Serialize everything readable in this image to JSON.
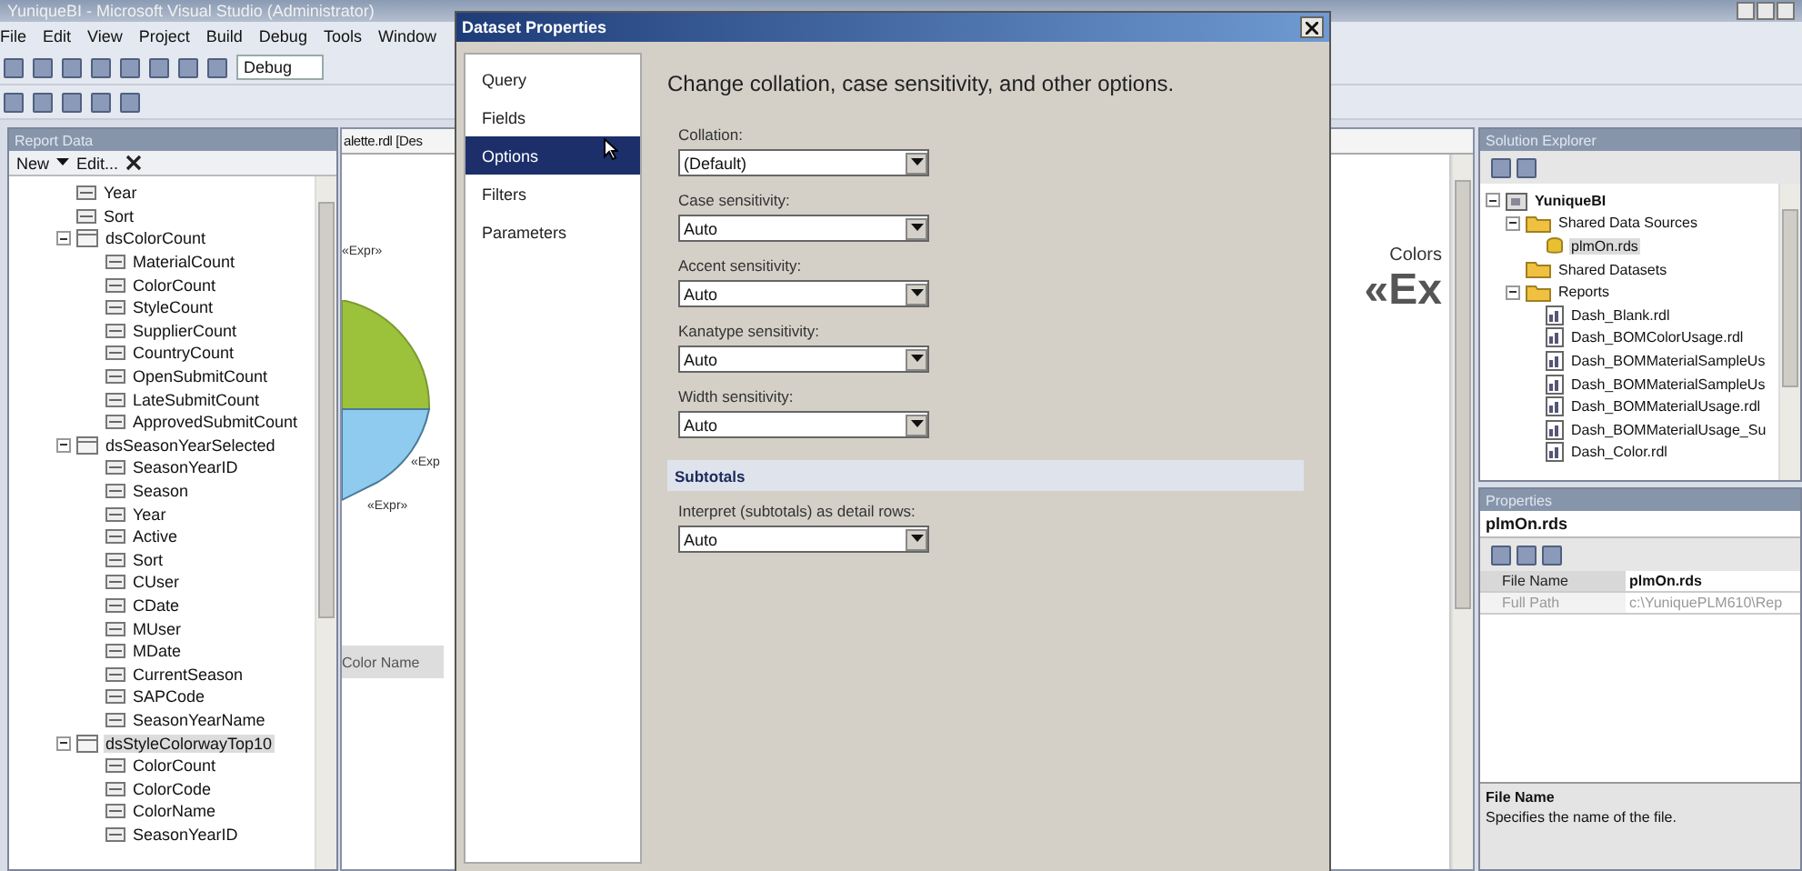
{
  "window": {
    "title": "YuniqueBI - Microsoft Visual Studio (Administrator)"
  },
  "menu": [
    "File",
    "Edit",
    "View",
    "Project",
    "Build",
    "Debug",
    "Tools",
    "Window"
  ],
  "toolbar": {
    "configuration": "Debug"
  },
  "report_data": {
    "title": "Report Data",
    "new": "New",
    "edit": "Edit...",
    "tree": [
      {
        "label": "Year",
        "kind": "field",
        "selected": false
      },
      {
        "label": "Sort",
        "kind": "field",
        "selected": false
      },
      {
        "label": "dsColorCount",
        "kind": "dataset",
        "expanded": true,
        "selected": false,
        "children": [
          {
            "label": "MaterialCount",
            "kind": "field",
            "selected": false
          },
          {
            "label": "ColorCount",
            "kind": "field",
            "selected": false
          },
          {
            "label": "StyleCount",
            "kind": "field",
            "selected": false
          },
          {
            "label": "SupplierCount",
            "kind": "field",
            "selected": false
          },
          {
            "label": "CountryCount",
            "kind": "field",
            "selected": false
          },
          {
            "label": "OpenSubmitCount",
            "kind": "field",
            "selected": false
          },
          {
            "label": "LateSubmitCount",
            "kind": "field",
            "selected": false
          },
          {
            "label": "ApprovedSubmitCount",
            "kind": "field",
            "selected": false
          }
        ]
      },
      {
        "label": "dsSeasonYearSelected",
        "kind": "dataset",
        "expanded": true,
        "selected": false,
        "children": [
          {
            "label": "SeasonYearID",
            "kind": "field",
            "selected": false
          },
          {
            "label": "Season",
            "kind": "field",
            "selected": false
          },
          {
            "label": "Year",
            "kind": "field",
            "selected": false
          },
          {
            "label": "Active",
            "kind": "field",
            "selected": false
          },
          {
            "label": "Sort",
            "kind": "field",
            "selected": false
          },
          {
            "label": "CUser",
            "kind": "field",
            "selected": false
          },
          {
            "label": "CDate",
            "kind": "field",
            "selected": false
          },
          {
            "label": "MUser",
            "kind": "field",
            "selected": false
          },
          {
            "label": "MDate",
            "kind": "field",
            "selected": false
          },
          {
            "label": "CurrentSeason",
            "kind": "field",
            "selected": false
          },
          {
            "label": "SAPCode",
            "kind": "field",
            "selected": false
          },
          {
            "label": "SeasonYearName",
            "kind": "field",
            "selected": false
          }
        ]
      },
      {
        "label": "dsStyleColorwayTop10",
        "kind": "dataset",
        "expanded": true,
        "selected": true,
        "children": [
          {
            "label": "ColorCount",
            "kind": "field",
            "selected": false
          },
          {
            "label": "ColorCode",
            "kind": "field",
            "selected": false
          },
          {
            "label": "ColorName",
            "kind": "field",
            "selected": false
          },
          {
            "label": "SeasonYearID",
            "kind": "field",
            "selected": false
          }
        ]
      }
    ]
  },
  "designer": {
    "tab": "alette.rdl [Des",
    "chart_labels": [
      "«Expr»",
      "«Exp",
      "«Expr»"
    ],
    "colors_label": "Colors",
    "big_expr": "«Ex",
    "column_header": "Color Name"
  },
  "dialog": {
    "title": "Dataset Properties",
    "nav": [
      {
        "label": "Query",
        "selected": false
      },
      {
        "label": "Fields",
        "selected": false
      },
      {
        "label": "Options",
        "selected": true
      },
      {
        "label": "Filters",
        "selected": false
      },
      {
        "label": "Parameters",
        "selected": false
      }
    ],
    "heading": "Change collation, case sensitivity, and other options.",
    "fields": [
      {
        "label": "Collation:",
        "value": "(Default)"
      },
      {
        "label": "Case sensitivity:",
        "value": "Auto"
      },
      {
        "label": "Accent sensitivity:",
        "value": "Auto"
      },
      {
        "label": "Kanatype sensitivity:",
        "value": "Auto"
      },
      {
        "label": "Width sensitivity:",
        "value": "Auto"
      }
    ],
    "section": "Subtotals",
    "subtotal_field": {
      "label": "Interpret (subtotals) as detail rows:",
      "value": "Auto"
    }
  },
  "solution_explorer": {
    "title": "Solution Explorer",
    "tree": [
      {
        "label": "YuniqueBI",
        "kind": "solution",
        "expanded": true,
        "selected": false,
        "children": [
          {
            "label": "Shared Data Sources",
            "kind": "folder",
            "expanded": true,
            "selected": false,
            "children": [
              {
                "label": "plmOn.rds",
                "kind": "datasource",
                "selected": true
              }
            ]
          },
          {
            "label": "Shared Datasets",
            "kind": "folder",
            "selected": false
          },
          {
            "label": "Reports",
            "kind": "folder",
            "expanded": true,
            "selected": false,
            "children": [
              {
                "label": "Dash_Blank.rdl",
                "kind": "report",
                "selected": false
              },
              {
                "label": "Dash_BOMColorUsage.rdl",
                "kind": "report",
                "selected": false
              },
              {
                "label": "Dash_BOMMaterialSampleUs",
                "kind": "report",
                "selected": false
              },
              {
                "label": "Dash_BOMMaterialSampleUs",
                "kind": "report",
                "selected": false
              },
              {
                "label": "Dash_BOMMaterialUsage.rdl",
                "kind": "report",
                "selected": false
              },
              {
                "label": "Dash_BOMMaterialUsage_Su",
                "kind": "report",
                "selected": false
              },
              {
                "label": "Dash_Color.rdl",
                "kind": "report",
                "selected": false
              }
            ]
          }
        ]
      }
    ]
  },
  "properties": {
    "title": "Properties",
    "object": "plmOn.rds",
    "rows": [
      {
        "name": "File Name",
        "value": "plmOn.rds",
        "disabled": false
      },
      {
        "name": "Full Path",
        "value": "c:\\YuniquePLM610\\Rep",
        "disabled": true
      }
    ],
    "description_title": "File Name",
    "description": "Specifies the name of the file."
  }
}
